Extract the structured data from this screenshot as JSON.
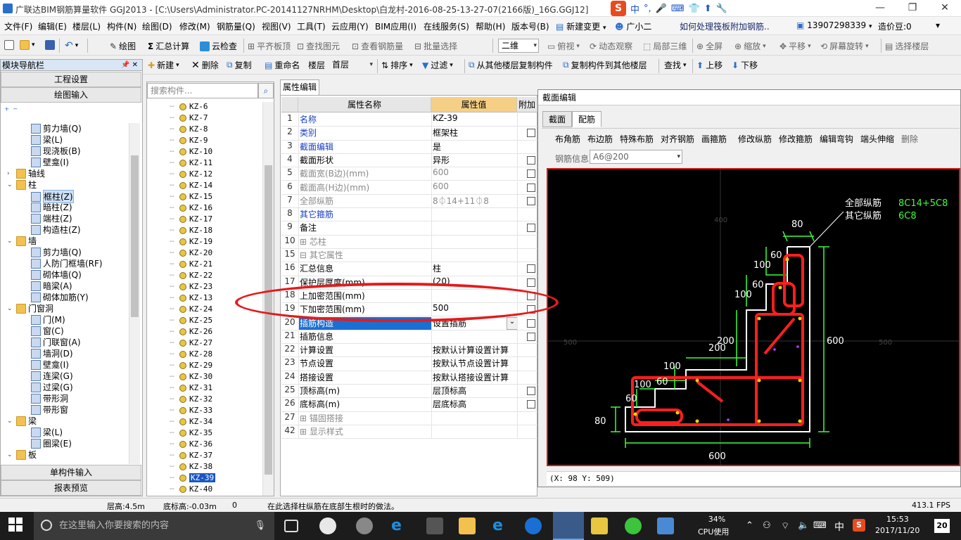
{
  "window": {
    "title": "广联达BIM钢筋算量软件 GGJ2013 - [C:\\Users\\Administrator.PC-20141127NRHM\\Desktop\\白龙村-2016-08-25-13-27-07(2166版)_16G.GGJ12]",
    "ime": [
      "中",
      "°,",
      "🎤",
      "⌨",
      "👕",
      "⬆",
      "🔧"
    ]
  },
  "menu": [
    "文件(F)",
    "编辑(E)",
    "楼层(L)",
    "构件(N)",
    "绘图(D)",
    "修改(M)",
    "钢筋量(Q)",
    "视图(V)",
    "工具(T)",
    "云应用(Y)",
    "BIM应用(I)",
    "在线服务(S)",
    "帮助(H)",
    "版本号(B)",
    "新建变更",
    "广小二",
    "如何处理筏板附加钢筋..",
    "13907298339",
    "造价豆:0"
  ],
  "toolbar1": [
    "绘图",
    "汇总计算",
    "云检查",
    "平齐板顶",
    "查找图元",
    "查看钢筋量",
    "批量选择",
    "二维",
    "俯视",
    "动态观察",
    "局部三维",
    "全屏",
    "缩放",
    "平移",
    "屏幕旋转",
    "选择楼层"
  ],
  "toolbar2": {
    "nav_title": "模块导航栏",
    "items": [
      "新建",
      "删除",
      "复制",
      "重命名",
      "楼层",
      "首层",
      "排序",
      "过滤",
      "从其他楼层复制构件",
      "复制构件到其他楼层",
      "查找",
      "上移",
      "下移"
    ]
  },
  "leftnav": {
    "top_buttons": [
      "工程设置",
      "绘图输入"
    ],
    "bottom_buttons": [
      "单构件输入",
      "报表预览"
    ],
    "tree": [
      {
        "label": "剪力墙(Q)",
        "level": 2
      },
      {
        "label": "梁(L)",
        "level": 2
      },
      {
        "label": "现浇板(B)",
        "level": 2
      },
      {
        "label": "壁龛(I)",
        "level": 2
      },
      {
        "label": "轴线",
        "level": 0,
        "folder": true,
        "exp": "›"
      },
      {
        "label": "柱",
        "level": 0,
        "folder": true,
        "exp": "⌄"
      },
      {
        "label": "框柱(Z)",
        "level": 2,
        "sel": true
      },
      {
        "label": "暗柱(Z)",
        "level": 2
      },
      {
        "label": "端柱(Z)",
        "level": 2
      },
      {
        "label": "构造柱(Z)",
        "level": 2
      },
      {
        "label": "墙",
        "level": 0,
        "folder": true,
        "exp": "⌄"
      },
      {
        "label": "剪力墙(Q)",
        "level": 2
      },
      {
        "label": "人防门框墙(RF)",
        "level": 2
      },
      {
        "label": "砌体墙(Q)",
        "level": 2
      },
      {
        "label": "暗梁(A)",
        "level": 2
      },
      {
        "label": "砌体加筋(Y)",
        "level": 2
      },
      {
        "label": "门窗洞",
        "level": 0,
        "folder": true,
        "exp": "⌄"
      },
      {
        "label": "门(M)",
        "level": 2
      },
      {
        "label": "窗(C)",
        "level": 2
      },
      {
        "label": "门联窗(A)",
        "level": 2
      },
      {
        "label": "墙洞(D)",
        "level": 2
      },
      {
        "label": "壁龛(I)",
        "level": 2
      },
      {
        "label": "连梁(G)",
        "level": 2
      },
      {
        "label": "过梁(G)",
        "level": 2
      },
      {
        "label": "带形洞",
        "level": 2
      },
      {
        "label": "带形窗",
        "level": 2
      },
      {
        "label": "梁",
        "level": 0,
        "folder": true,
        "exp": "⌄"
      },
      {
        "label": "梁(L)",
        "level": 2
      },
      {
        "label": "圈梁(E)",
        "level": 2
      },
      {
        "label": "板",
        "level": 0,
        "folder": true,
        "exp": "⌄"
      }
    ]
  },
  "complist": {
    "search_placeholder": "搜索构件...",
    "items": [
      "KZ-6",
      "KZ-7",
      "KZ-8",
      "KZ-9",
      "KZ-10",
      "KZ-11",
      "KZ-12",
      "KZ-14",
      "KZ-15",
      "KZ-16",
      "KZ-17",
      "KZ-18",
      "KZ-19",
      "KZ-20",
      "KZ-21",
      "KZ-22",
      "KZ-23",
      "KZ-13",
      "KZ-24",
      "KZ-25",
      "KZ-26",
      "KZ-27",
      "KZ-28",
      "KZ-29",
      "KZ-30",
      "KZ-31",
      "KZ-32",
      "KZ-33",
      "KZ-34",
      "KZ-35",
      "KZ-36",
      "KZ-37",
      "KZ-38",
      "KZ-39",
      "KZ-40"
    ],
    "selected": "KZ-39"
  },
  "props": {
    "tab": "属性编辑",
    "headers": [
      "属性名称",
      "属性值",
      "附加"
    ],
    "rows": [
      {
        "n": "1",
        "k": "名称",
        "v": "KZ-39",
        "style": "blue",
        "cb": false
      },
      {
        "n": "2",
        "k": "类别",
        "v": "框架柱",
        "style": "blue",
        "cb": true
      },
      {
        "n": "3",
        "k": "截面编辑",
        "v": "是",
        "style": "blue",
        "cb": false
      },
      {
        "n": "4",
        "k": "截面形状",
        "v": "异形",
        "style": "",
        "cb": true
      },
      {
        "n": "5",
        "k": "截面宽(B边)(mm)",
        "v": "600",
        "style": "gray",
        "cb": true
      },
      {
        "n": "6",
        "k": "截面高(H边)(mm)",
        "v": "600",
        "style": "gray",
        "cb": true
      },
      {
        "n": "7",
        "k": "全部纵筋",
        "v": "8⏀14+11⏀8",
        "style": "gray",
        "cb": true
      },
      {
        "n": "8",
        "k": "其它箍筋",
        "v": "",
        "style": "blue",
        "cb": false
      },
      {
        "n": "9",
        "k": "备注",
        "v": "",
        "style": "",
        "cb": true
      },
      {
        "n": "10",
        "k": "⊞ 芯柱",
        "v": "",
        "style": "gray",
        "cb": false
      },
      {
        "n": "15",
        "k": "⊟ 其它属性",
        "v": "",
        "style": "gray",
        "cb": false
      },
      {
        "n": "16",
        "k": "  汇总信息",
        "v": "柱",
        "style": "",
        "cb": true
      },
      {
        "n": "17",
        "k": "  保护层厚度(mm)",
        "v": "(20)",
        "style": "",
        "cb": true
      },
      {
        "n": "18",
        "k": "  上加密范围(mm)",
        "v": "",
        "style": "",
        "cb": true
      },
      {
        "n": "19",
        "k": "  下加密范围(mm)",
        "v": "500",
        "style": "",
        "cb": true
      },
      {
        "n": "20",
        "k": "  插筋构造",
        "v": "设置插筋",
        "style": "sel",
        "cb": true
      },
      {
        "n": "21",
        "k": "  插筋信息",
        "v": "",
        "style": "",
        "cb": true
      },
      {
        "n": "22",
        "k": "  计算设置",
        "v": "按默认计算设置计算",
        "style": "",
        "cb": false
      },
      {
        "n": "23",
        "k": "  节点设置",
        "v": "按默认节点设置计算",
        "style": "",
        "cb": false
      },
      {
        "n": "24",
        "k": "  搭接设置",
        "v": "按默认搭接设置计算",
        "style": "",
        "cb": false
      },
      {
        "n": "25",
        "k": "  顶标高(m)",
        "v": "层顶标高",
        "style": "",
        "cb": true
      },
      {
        "n": "26",
        "k": "  底标高(m)",
        "v": "层底标高",
        "style": "",
        "cb": true
      },
      {
        "n": "27",
        "k": "⊞ 锚固搭接",
        "v": "",
        "style": "gray",
        "cb": false
      },
      {
        "n": "42",
        "k": "⊞ 显示样式",
        "v": "",
        "style": "gray",
        "cb": false
      }
    ]
  },
  "section": {
    "title": "截面编辑",
    "tabs": [
      "截面",
      "配筋"
    ],
    "buttons": [
      "布角筋",
      "布边筋",
      "特殊布筋",
      "对齐钢筋",
      "画箍筋",
      "修改纵筋",
      "修改箍筋",
      "编辑弯钩",
      "端头伸缩",
      "删除"
    ],
    "rebar_label": "钢筋信息",
    "rebar_value": "A6@200",
    "legend_all": "全部纵筋",
    "legend_all_val": "8C14+5C8",
    "legend_other": "其它纵筋",
    "legend_other_val": "6C8",
    "dims": {
      "d80a": "80",
      "d60a": "60",
      "d100a": "100",
      "d60b": "60",
      "d100b": "100",
      "d200a": "200",
      "d200b": "200",
      "d100c": "100",
      "d100d": "100",
      "d60c": "60",
      "d60d": "60",
      "d80b": "80",
      "d600r": "600",
      "d600b": "600"
    },
    "grid_labels": [
      "400",
      "500",
      "500"
    ],
    "coord": "(X: 98 Y: 509)"
  },
  "status": {
    "floor_h": "层高:4.5m",
    "bottom": "底标高:-0.03m",
    "zero": "0",
    "hint": "在此选择柱纵筋在底部生根时的做法。",
    "fps": "413.1 FPS"
  },
  "taskbar": {
    "search": "在这里输入你要搜索的内容",
    "cpu_pct": "34%",
    "cpu_label": "CPU使用",
    "lang": "中",
    "time": "15:53",
    "date": "2017/11/20",
    "notif": "20"
  }
}
